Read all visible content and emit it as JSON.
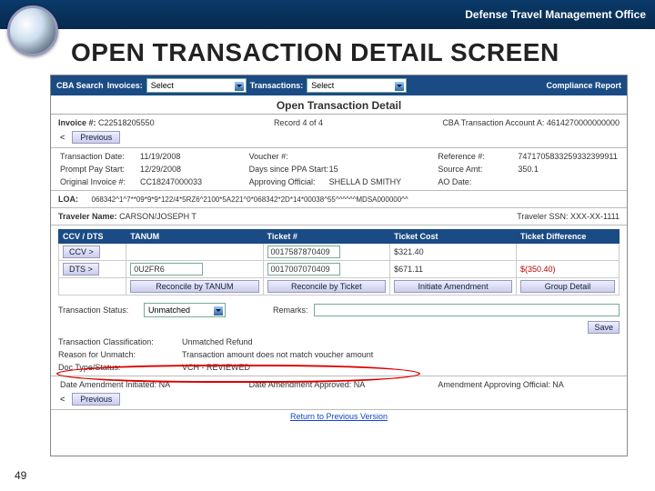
{
  "header": {
    "office": "Defense Travel Management Office"
  },
  "slide": {
    "title": "OPEN TRANSACTION DETAIL SCREEN",
    "number": "49"
  },
  "toolbar": {
    "search_lbl": "CBA Search",
    "inv_lbl": "Invoices:",
    "inv_sel": "Select",
    "trn_lbl": "Transactions:",
    "trn_sel": "Select",
    "report_btn": "Compliance Report"
  },
  "title2": "Open Transaction Detail",
  "nav": {
    "prev": "Previous",
    "record": "Record 4 of 4"
  },
  "acct": {
    "lbl": "CBA Transaction Account A:",
    "val": "4614270000000000"
  },
  "invoice": {
    "lbl": "Invoice #:",
    "val": "C22518205550"
  },
  "details": {
    "tdate_l": "Transaction Date:",
    "tdate": "11/19/2008",
    "vnum_l": "Voucher #:",
    "vnum": "",
    "ref_l": "Reference #:",
    "ref": "74717058332593323999111",
    "pps_l": "Prompt Pay Start:",
    "pps": "12/29/2008",
    "dpp_l": "Days since PPA Start:",
    "dpp": "15",
    "src_l": "Source Amt:",
    "src": "350.1",
    "oinv_l": "Original Invoice #:",
    "oinv": "CC18247000033",
    "ao_l": "Approving Official:",
    "ao": "SHELLA D SMITHY",
    "adt_l": "AO Date:"
  },
  "loa": {
    "lbl": "LOA:",
    "val": "068342^1^7**09*9*9*122/4*5RZ6^2100*5A221^0*068342*2D*14*00038^55^^^^^^MDSA000000^^"
  },
  "traveler": {
    "name_l": "Traveler Name:",
    "name": "CARSON/JOSEPH T",
    "ssn_l": "Traveler SSN:",
    "ssn": "XXX-XX-1111"
  },
  "grid": {
    "h1": "CCV / DTS",
    "h2": "TANUM",
    "h3": "Ticket #",
    "h4": "Ticket Cost",
    "h5": "Ticket Difference",
    "r1c1": "CCV >",
    "r1c3": "0017587870409",
    "r1c4": "$321.40",
    "r2c1": "DTS >",
    "r2c2": "0U2FR6",
    "r2c3": "0017007070409",
    "r2c4": "$671.11",
    "r2c5": "$(350.40)",
    "b1": "Reconcile by TANUM",
    "b2": "Reconcile by Ticket",
    "b3": "Initiate Amendment",
    "b4": "Group Detail"
  },
  "status": {
    "ts_l": "Transaction Status:",
    "ts": "Unmatched",
    "rem_l": "Remarks:",
    "save": "Save",
    "tc_l": "Transaction Classification:",
    "tc": "Unmatched Refund",
    "ru_l": "Reason for Unmatch:",
    "ru": "Transaction amount does not match voucher amount",
    "dt_l": "Doc Type/Status:",
    "dt": "VCH - REVIEWED"
  },
  "amend": {
    "ai_l": "Date Amendment Initiated:",
    "ai": "NA",
    "aa_l": "Date Amendment Approved:",
    "aa": "NA",
    "ao_l": "Amendment Approving Official:",
    "ao": "NA"
  },
  "footer": {
    "link": "Return to Previous Version"
  }
}
